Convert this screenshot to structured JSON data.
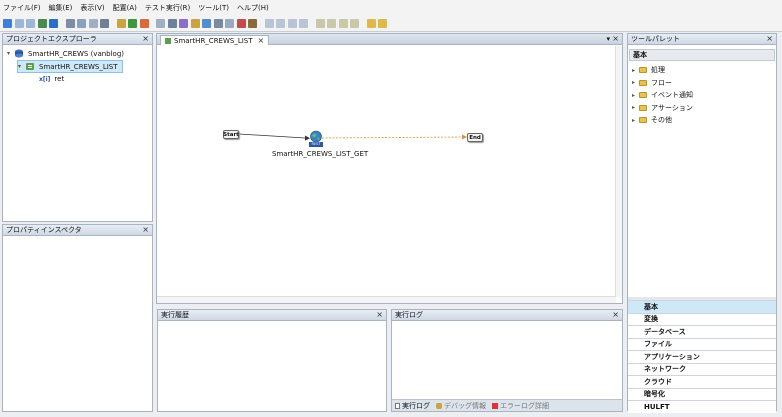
{
  "menu": [
    "ファイル(F)",
    "編集(E)",
    "表示(V)",
    "配置(A)",
    "テスト実行(R)",
    "ツール(T)",
    "ヘルプ(H)"
  ],
  "toolbar_colors": [
    "#3f7fd6",
    "#9db7d8",
    "#9db7d8",
    "#4a8a4a",
    "#2a6fc4",
    "#7d8da8",
    "#8aa0bd",
    "#9fb0c6",
    "#6e7f99",
    "#c9a441",
    "#3a9a3a",
    "#d96a3a",
    "#9fb0c6",
    "#6e7f99",
    "#8a6ec9",
    "#c9a441",
    "#4f8fd1",
    "#7a8aa0",
    "#9aa9bd",
    "#c24a4a",
    "#8a6a3a",
    "#b9c5d6",
    "#b9c5d6",
    "#b9c5d6",
    "#b9c5d6",
    "#c9c9a9",
    "#c9c9a9",
    "#c9c9a9",
    "#c9c9a9",
    "#e0b94a",
    "#e0b94a"
  ],
  "explorer": {
    "title": "プロジェクトエクスプローラ",
    "project": "SmartHR_CREWS (vanblog)",
    "script": "SmartHR_CREWS_LIST",
    "variable": "ret"
  },
  "inspector": {
    "title": "プロパティインスペクタ"
  },
  "editor": {
    "tab_label": "SmartHR_CREWS_LIST",
    "start_label": "Start",
    "end_label": "End",
    "rest_badge": "REST",
    "component_label": "SmartHR_CREWS_LIST_GET"
  },
  "history": {
    "title": "実行履歴"
  },
  "log": {
    "title": "実行ログ",
    "tabs": [
      "実行ログ",
      "デバッグ情報",
      "エラーログ詳細"
    ]
  },
  "palette": {
    "title": "ツールパレット",
    "section": "基本",
    "items": [
      "処理",
      "フロー",
      "イベント通知",
      "アサーション",
      "その他"
    ],
    "categories": [
      "基本",
      "変換",
      "データベース",
      "ファイル",
      "アプリケーション",
      "ネットワーク",
      "クラウド",
      "暗号化",
      "HULFT"
    ]
  },
  "colors": {
    "accent_selected": "#cfe8f7",
    "flow_line": "#e0902c",
    "title_gradient": "#d3dce8"
  }
}
